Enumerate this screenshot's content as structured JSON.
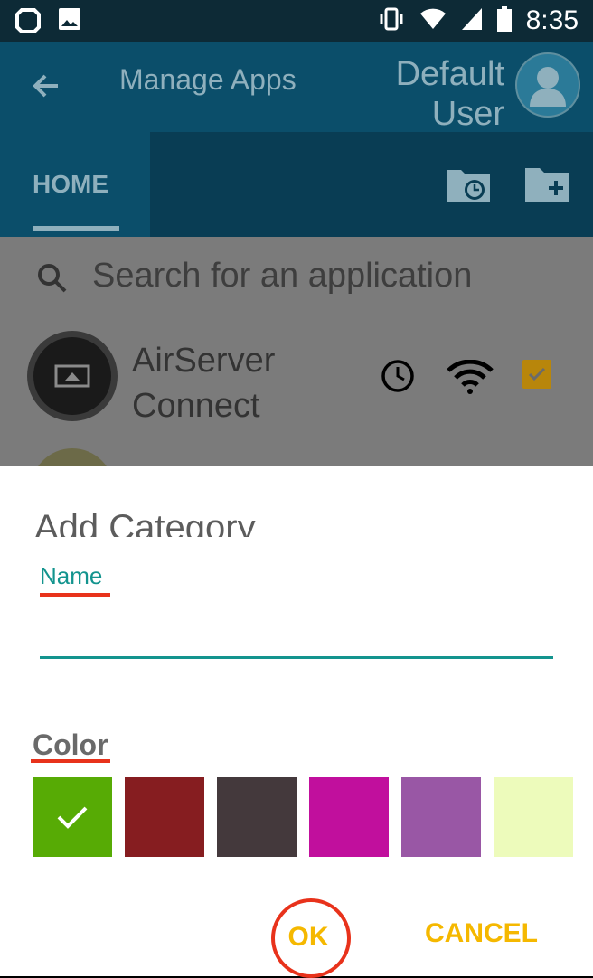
{
  "status_bar": {
    "time": "8:35",
    "icons_left": [
      "status-app-icon",
      "image-icon"
    ],
    "icons_right": [
      "vibrate-icon",
      "wifi-icon",
      "signal-icon",
      "battery-icon"
    ]
  },
  "app_bar": {
    "title": "Manage Apps",
    "user_name": "Default User"
  },
  "tabs": {
    "home_label": "HOME",
    "actions": [
      "folder-clock-icon",
      "folder-add-icon"
    ]
  },
  "search": {
    "placeholder": "Search for an application"
  },
  "apps": [
    {
      "name": "AirServer Connect",
      "checked": true
    }
  ],
  "dialog": {
    "title": "Add Category",
    "name_label": "Name",
    "name_value": "",
    "color_label": "Color",
    "colors": [
      "#57ab05",
      "#861d20",
      "#44393c",
      "#c10f9d",
      "#9957a5",
      "#edfbbb"
    ],
    "selected_color_index": 0,
    "ok_label": "OK",
    "cancel_label": "CANCEL"
  },
  "theme": {
    "accent_teal": "#13948e",
    "button_yellow": "#f5b800",
    "annotation_red": "#e8321b"
  }
}
